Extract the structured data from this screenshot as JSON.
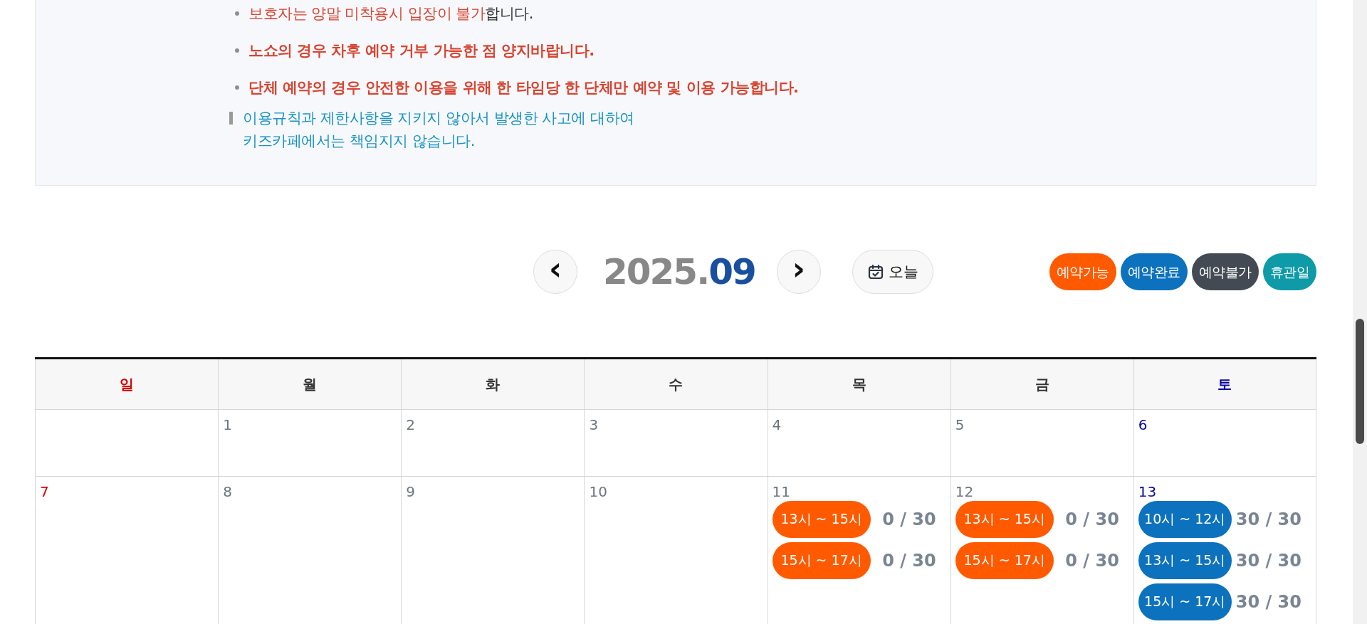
{
  "notice": {
    "bullets": [
      {
        "bold": false,
        "segments": [
          {
            "text": "보호자는 양말 미착용시 입장이 불가",
            "kind": "alert"
          },
          {
            "text": "합니다.",
            "kind": "plain"
          }
        ]
      },
      {
        "bold": true,
        "segments": [
          {
            "text": "노쇼의 경우 차후 예약 거부 가능한 점 양지바랍니다.",
            "kind": "alert"
          }
        ]
      },
      {
        "bold": true,
        "segments": [
          {
            "text": "단체 예약의 경우 안전한 이용을 위해 한 타임당 한 단체만 예약 및 이용 가능합니다.",
            "kind": "alert"
          }
        ]
      }
    ],
    "disclaimer": [
      "이용규칙과 제한사항을 지키지 않아서 발생한 사고에 대하여",
      "키즈카페에서는 책임지지 않습니다."
    ]
  },
  "calendar": {
    "year": "2025.",
    "month": "09",
    "prev": "‹",
    "next": "›",
    "today": "오늘",
    "legend": [
      {
        "label": "예약가능",
        "color": "#ff5a00"
      },
      {
        "label": "예약완료",
        "color": "#0d72bd"
      },
      {
        "label": "예약불가",
        "color": "#434a54"
      },
      {
        "label": "휴관일",
        "color": "#0e9aa7"
      }
    ],
    "weekdays": [
      "일",
      "월",
      "화",
      "수",
      "목",
      "금",
      "토"
    ],
    "weeks": [
      [
        {
          "date": "1"
        },
        {
          "date": "2"
        },
        {
          "date": "3"
        },
        {
          "date": "4"
        },
        {
          "date": "5"
        },
        {
          "date": "6"
        }
      ],
      [
        {
          "date": "7"
        },
        {
          "date": "8"
        },
        {
          "date": "9"
        },
        {
          "date": "10"
        },
        {
          "date": "11",
          "slots": [
            {
              "time": "13시 ~ 15시",
              "count": "0 / 30",
              "kind": "available"
            },
            {
              "time": "15시 ~ 17시",
              "count": "0 / 30",
              "kind": "available"
            }
          ]
        },
        {
          "date": "12",
          "slots": [
            {
              "time": "13시 ~ 15시",
              "count": "0 / 30",
              "kind": "available"
            },
            {
              "time": "15시 ~ 17시",
              "count": "0 / 30",
              "kind": "available"
            }
          ]
        },
        {
          "date": "13",
          "slots": [
            {
              "time": "10시 ~ 12시",
              "count": "30 / 30",
              "kind": "booked"
            },
            {
              "time": "13시 ~ 15시",
              "count": "30 / 30",
              "kind": "booked"
            },
            {
              "time": "15시 ~ 17시",
              "count": "30 / 30",
              "kind": "booked"
            }
          ]
        }
      ]
    ]
  }
}
